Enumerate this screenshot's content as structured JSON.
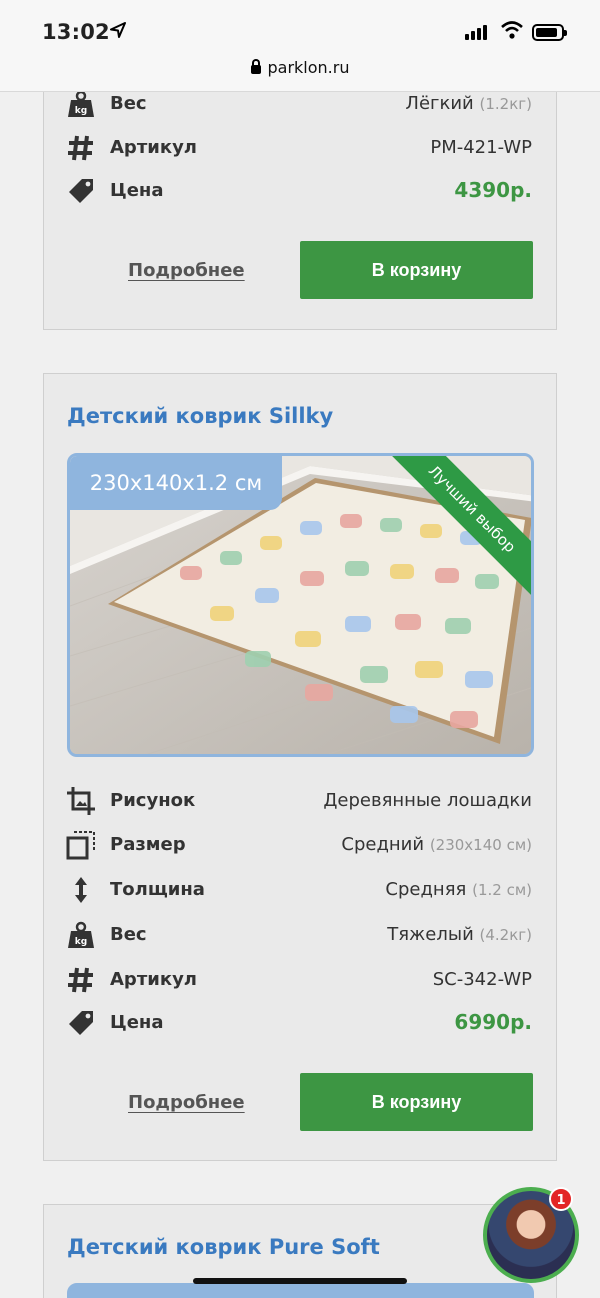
{
  "status_bar": {
    "time": "13:02",
    "url": "parklon.ru"
  },
  "card1": {
    "specs": [
      {
        "label": "Вес",
        "value": "Лёгкий",
        "note": "(1.2кг)"
      },
      {
        "label": "Артикул",
        "value": "PM-421-WP",
        "note": ""
      },
      {
        "label": "Цена",
        "value": "4390р.",
        "note": ""
      }
    ],
    "more_label": "Подробнее",
    "cart_label": "В корзину"
  },
  "card2": {
    "title": "Детский коврик Sillky",
    "size_badge": "230x140x1.2 см",
    "ribbon": "Лучший выбор",
    "specs": [
      {
        "label": "Рисунок",
        "value": "Деревянные лошадки",
        "note": ""
      },
      {
        "label": "Размер",
        "value": "Средний",
        "note": "(230x140 см)"
      },
      {
        "label": "Толщина",
        "value": "Средняя",
        "note": "(1.2 см)"
      },
      {
        "label": "Вес",
        "value": "Тяжелый",
        "note": "(4.2кг)"
      },
      {
        "label": "Артикул",
        "value": "SC-342-WP",
        "note": ""
      },
      {
        "label": "Цена",
        "value": "6990р.",
        "note": ""
      }
    ],
    "more_label": "Подробнее",
    "cart_label": "В корзину"
  },
  "card3": {
    "title": "Детский коврик Pure Soft"
  },
  "chat": {
    "unread": "1"
  },
  "colors": {
    "accent_green": "#3d9643",
    "title_blue": "#3a7ac0",
    "badge_blue": "#8fb5de",
    "ribbon_green": "#2e9a45"
  }
}
